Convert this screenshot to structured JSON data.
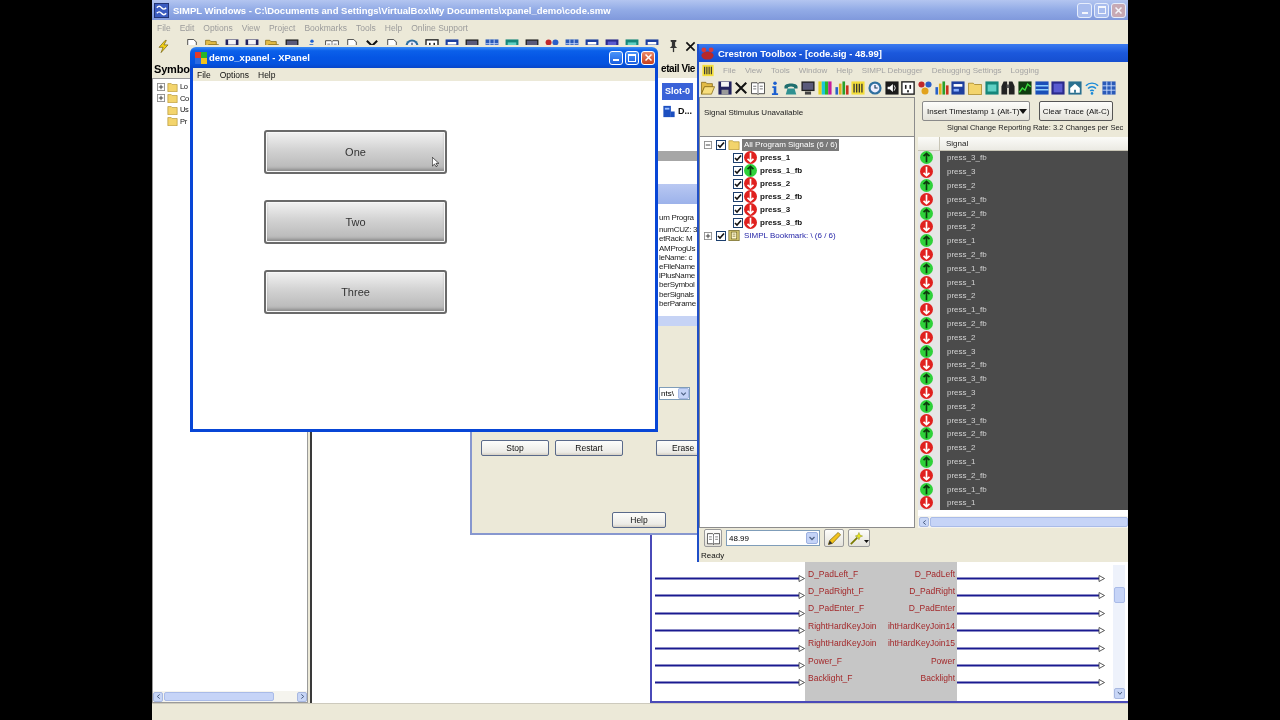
{
  "simpl_window": {
    "title": "SIMPL Windows - C:\\Documents and Settings\\VirtualBox\\My Documents\\xpanel_demo\\code.smw",
    "menu": [
      "File",
      "Edit",
      "Options",
      "View",
      "Project",
      "Bookmarks",
      "Tools",
      "Help",
      "Online Support"
    ],
    "symbol_pane": {
      "title": "Symbo",
      "tree": [
        {
          "label": "Lo",
          "kind": "group",
          "expanded": false
        },
        {
          "label": "Co",
          "kind": "group",
          "expanded": false
        },
        {
          "label": "Us",
          "kind": "item"
        },
        {
          "label": "Pr",
          "kind": "item"
        }
      ]
    },
    "detail_view": {
      "title": "etail Vie",
      "tab": "Slot-0",
      "item": "D..."
    },
    "diagram": {
      "rows": [
        {
          "input": "D_PadLeft_F",
          "output": "D_PadLeft"
        },
        {
          "input": "D_PadRight_F",
          "output": "D_PadRight"
        },
        {
          "input": "D_PadEnter_F",
          "output": "D_PadEnter"
        },
        {
          "input": "RightHardKeyJoin",
          "output": "ihtHardKeyJoin14"
        },
        {
          "input": "RightHardKeyJoin",
          "output": "ihtHardKeyJoin15"
        },
        {
          "input": "Power_F",
          "output": "Power"
        },
        {
          "input": "Backlight_F",
          "output": "Backlight"
        }
      ]
    }
  },
  "program_dialog": {
    "info_lines": [
      "um Progra",
      "numCUZ: 3",
      "etRack: M",
      "AMProgUs",
      "leName: c",
      "eFileName",
      "lPlusName",
      "berSymbol",
      "berSignals",
      "berParame"
    ],
    "path_dropdown": "nts\\",
    "buttons": [
      "Stop",
      "Restart",
      "Erase"
    ],
    "help_button": "Help"
  },
  "xpanel": {
    "title": "demo_xpanel - XPanel",
    "menu": [
      "File",
      "Options",
      "Help"
    ],
    "buttons": [
      "One",
      "Two",
      "Three"
    ]
  },
  "toolbox": {
    "title": "Crestron Toolbox - [code.sig - 48.99]",
    "menu": [
      "File",
      "View",
      "Tools",
      "Window",
      "Help",
      "SIMPL Debugger",
      "Debugging Settings",
      "Logging"
    ],
    "stimulus_header": "Signal Stimulus Unavailable",
    "signal_tree": [
      {
        "label": "All Program Signals (6 / 6)",
        "kind": "folder",
        "expanded": true,
        "checked": true,
        "selected": true,
        "children": [
          {
            "label": "press_1",
            "checked": true,
            "selected": false,
            "on": false
          },
          {
            "label": "press_1_fb",
            "checked": true,
            "selected": false,
            "on": true
          },
          {
            "label": "press_2",
            "checked": true,
            "selected": false,
            "on": false
          },
          {
            "label": "press_2_fb",
            "checked": true,
            "selected": false,
            "on": false
          },
          {
            "label": "press_3",
            "checked": true,
            "selected": false,
            "on": false
          },
          {
            "label": "press_3_fb",
            "checked": true,
            "selected": false,
            "on": false
          }
        ]
      },
      {
        "label": "SIMPL Bookmark: \\ (6 / 6)",
        "kind": "bookmark",
        "expanded": false,
        "checked": true,
        "selected": false
      }
    ],
    "timestamp_button": "Insert Timestamp 1 (Alt-T)",
    "clear_button": "Clear Trace (Alt-C)",
    "rate": "Signal Change Reporting Rate: 3.2 Changes per Sec",
    "trace_columns": [
      "Signal"
    ],
    "trace_rows": [
      {
        "signal": "press_3_fb",
        "on": true
      },
      {
        "signal": "press_3",
        "on": false
      },
      {
        "signal": "press_2",
        "on": true
      },
      {
        "signal": "press_3_fb",
        "on": false
      },
      {
        "signal": "press_2_fb",
        "on": true
      },
      {
        "signal": "press_2",
        "on": false
      },
      {
        "signal": "press_1",
        "on": true
      },
      {
        "signal": "press_2_fb",
        "on": false
      },
      {
        "signal": "press_1_fb",
        "on": true
      },
      {
        "signal": "press_1",
        "on": false
      },
      {
        "signal": "press_2",
        "on": true
      },
      {
        "signal": "press_1_fb",
        "on": false
      },
      {
        "signal": "press_2_fb",
        "on": true
      },
      {
        "signal": "press_2",
        "on": false
      },
      {
        "signal": "press_3",
        "on": true
      },
      {
        "signal": "press_2_fb",
        "on": false
      },
      {
        "signal": "press_3_fb",
        "on": true
      },
      {
        "signal": "press_3",
        "on": false
      },
      {
        "signal": "press_2",
        "on": true
      },
      {
        "signal": "press_3_fb",
        "on": false
      },
      {
        "signal": "press_2_fb",
        "on": true
      },
      {
        "signal": "press_2",
        "on": false
      },
      {
        "signal": "press_1",
        "on": true
      },
      {
        "signal": "press_2_fb",
        "on": false
      },
      {
        "signal": "press_1_fb",
        "on": true
      },
      {
        "signal": "press_1",
        "on": false
      }
    ],
    "version_combo": "48.99",
    "status": "Ready"
  }
}
